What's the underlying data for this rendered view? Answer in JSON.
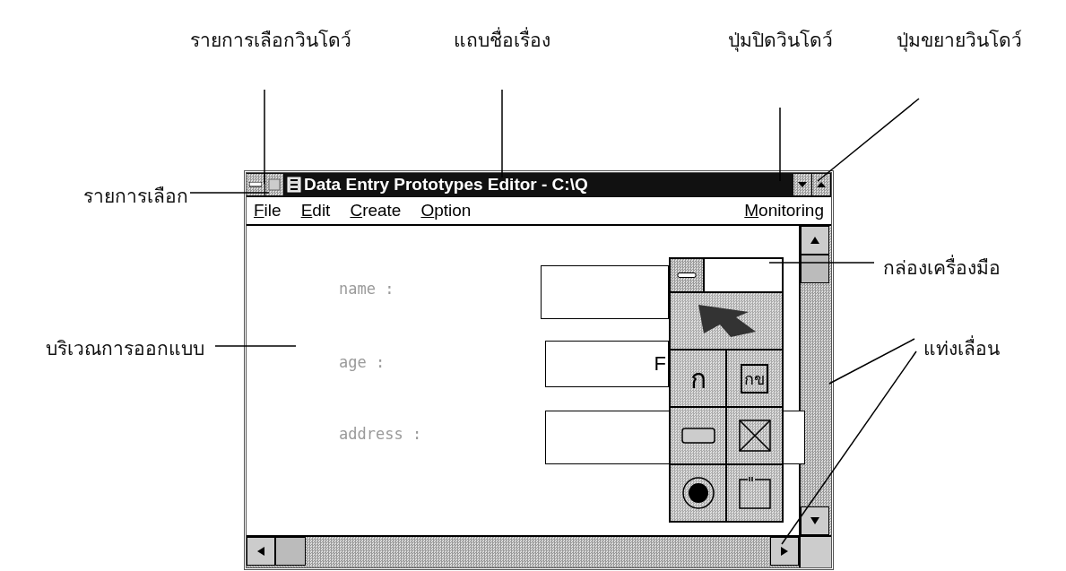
{
  "callouts": [
    {
      "text": "รายการเลือกวินโดว์"
    },
    {
      "text": "แถบชื่อเรื่อง"
    },
    {
      "text": "ปุ่มปิดวินโดว์"
    },
    {
      "text": "ปุ่มขยายวินโดว์"
    },
    {
      "text": "รายการเลือก"
    },
    {
      "text": "บริเวณการออกแบบ"
    },
    {
      "text": "กล่องเครื่องมือ"
    },
    {
      "text": "แท่งเลื่อน"
    }
  ],
  "window": {
    "title": "Data Entry Prototypes Editor - C:\\Q"
  },
  "menu": [
    {
      "label": "File"
    },
    {
      "label": "Edit"
    },
    {
      "label": "Create"
    },
    {
      "label": "Option"
    },
    {
      "label": "Monitoring"
    }
  ],
  "form_fields": [
    {
      "label": "name :"
    },
    {
      "label": "age :",
      "value": "F"
    },
    {
      "label": "address :"
    }
  ],
  "toolbox": {
    "tools": [
      {
        "kind": "pointer"
      },
      {
        "kind": "label",
        "glyph": "ก"
      },
      {
        "kind": "text",
        "glyph": "กข"
      },
      {
        "kind": "button"
      },
      {
        "kind": "checkbox"
      },
      {
        "kind": "radio"
      },
      {
        "kind": "group"
      }
    ]
  }
}
